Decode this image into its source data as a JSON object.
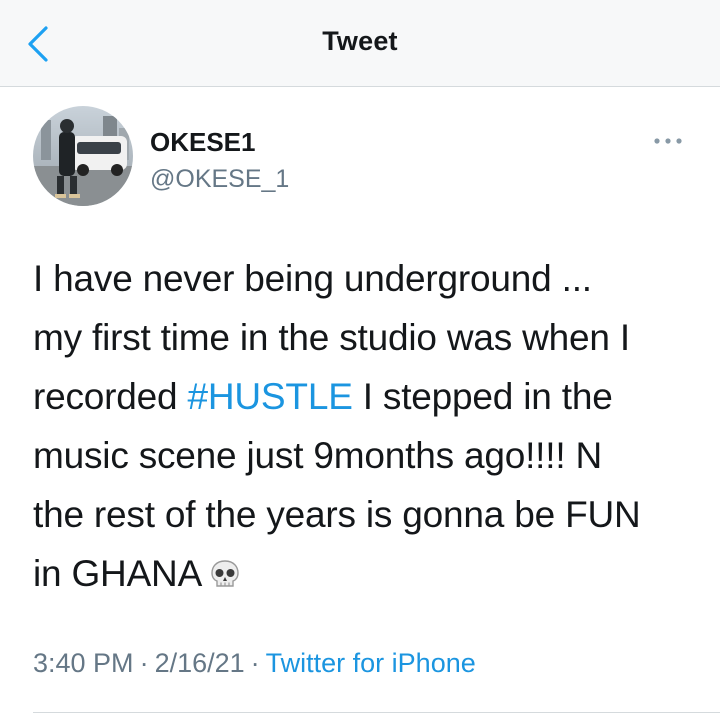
{
  "header": {
    "title": "Tweet",
    "back_icon": "chevron-left-icon",
    "accent": "#1da1f2"
  },
  "user": {
    "display_name": "OKESE1",
    "handle": "@OKESE_1"
  },
  "tweet": {
    "line1": "I have never being underground ...",
    "line2": "my first time in the studio was when I",
    "line3_pre": "recorded ",
    "hashtag": "#HUSTLE",
    "line3_post": " I stepped in the",
    "line4": "music scene just 9months ago!!!! N",
    "line5": "the rest of the years is gonna be FUN",
    "line6": "in GHANA",
    "emoji": "skull-icon",
    "hashtag_color": "#1b95e0"
  },
  "meta": {
    "time": "3:40 PM",
    "date": "2/16/21",
    "separator": "·",
    "source": "Twitter for iPhone"
  },
  "more_icon": "ellipsis-icon"
}
